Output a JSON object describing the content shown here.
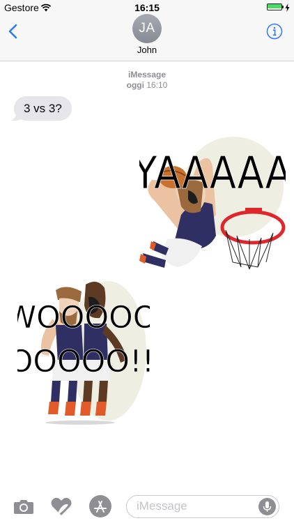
{
  "status_bar": {
    "carrier": "Gestore",
    "time": "16:15",
    "battery_level": 1.0,
    "battery_color": "#4cd964"
  },
  "nav": {
    "back_icon": "chevron-left-icon",
    "avatar_initials": "JA",
    "contact_name": "John",
    "info_icon": "info-icon",
    "accent_color": "#2a7cf6"
  },
  "conversation": {
    "service_label": "iMessage",
    "day_label": "oggi",
    "time_label": "16:10",
    "messages": [
      {
        "direction": "incoming",
        "text": "3 vs 3?"
      }
    ],
    "stickers": [
      {
        "direction": "outgoing",
        "caption": "YAAAAA"
      },
      {
        "direction": "incoming",
        "caption_line1": "WOOOOO",
        "caption_line2": "OOOOO!!"
      }
    ]
  },
  "input_bar": {
    "camera_icon": "camera-icon",
    "digital_touch_icon": "digital-touch-heart-icon",
    "appstore_icon": "app-store-icon",
    "placeholder": "iMessage",
    "mic_icon": "microphone-icon"
  }
}
